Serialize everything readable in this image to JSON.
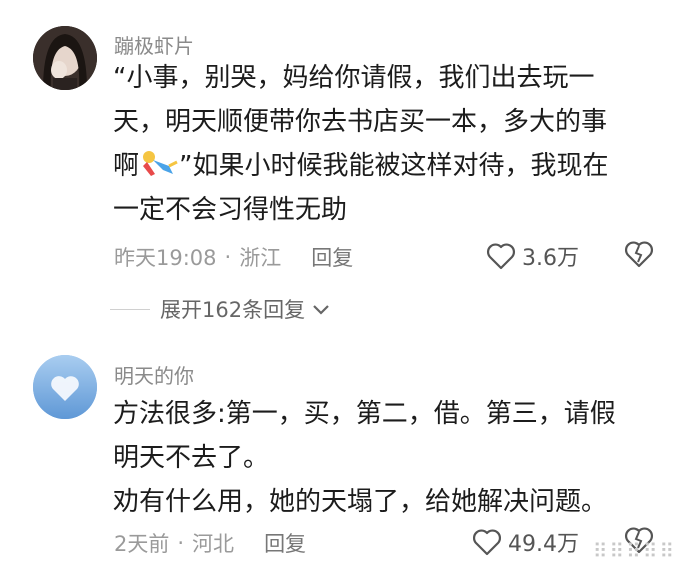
{
  "comments": [
    {
      "username": "蹦极虾片",
      "text_line1": "“小事，别哭，妈给你请假，我们出去玩一",
      "text_line2": "天，明天顺便带你去书店买一本，多大的事",
      "text_line3_prefix": "啊",
      "text_line3_suffix": "”如果小时候我能被这样对待，我现在",
      "text_line4": "一定不会习得性无助",
      "time": "昨天19:08",
      "location": "浙江",
      "reply_label": "回复",
      "likes": "3.6万",
      "emoji": "person-fall-emoji"
    },
    {
      "username": "明天的你",
      "text_line1": "方法很多:第一，买，第二，借。第三，请假",
      "text_line2": "明天不去了。",
      "text_line3": "劝有什么用，她的天塌了，给她解决问题。",
      "time": "2天前",
      "location": "河北",
      "reply_label": "回复",
      "likes": "49.4万"
    }
  ],
  "expand_replies": "展开162条回复",
  "watermark_dots": "⠿⠿⠿⠿⠿",
  "icons": {
    "heart": "heart-icon",
    "dislike": "broken-heart-icon",
    "chevron": "chevron-down-icon"
  }
}
